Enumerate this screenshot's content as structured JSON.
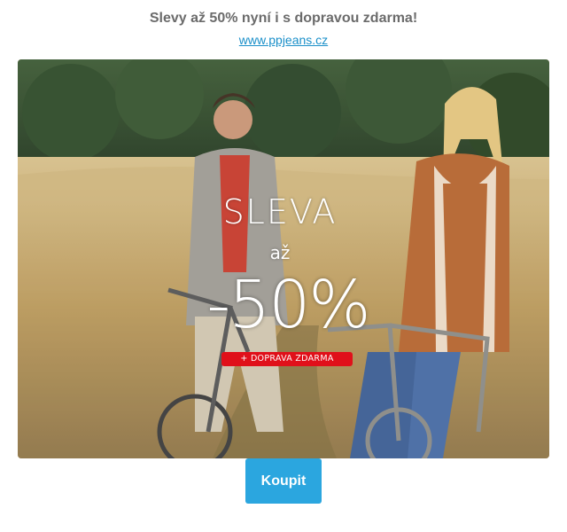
{
  "header": {
    "headline": "Slevy až 50% nyní i s dopravou zdarma!",
    "link_text": "www.ppjeans.cz"
  },
  "banner": {
    "title": "SLEVA",
    "prefix": "až",
    "discount": "-50%",
    "tagline": "+ DOPRAVA ZDARMA"
  },
  "cta": {
    "label": "Koupit"
  },
  "colors": {
    "headline": "#6b6b6b",
    "link": "#1a8fc9",
    "button": "#2ba6df",
    "badge": "#e0101a"
  }
}
